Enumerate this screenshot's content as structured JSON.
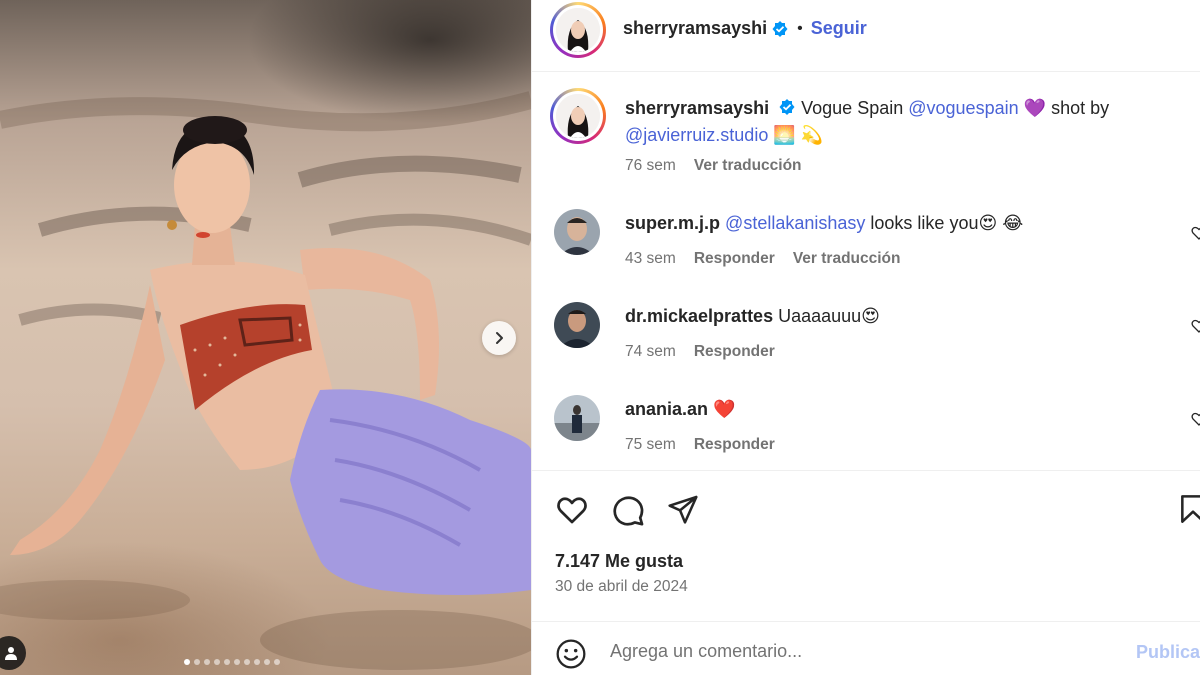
{
  "post": {
    "author": "sherryramsayshi",
    "follow_label": "Seguir",
    "separator": "•",
    "caption": {
      "prefix": "Vogue Spain",
      "mention_1": "@voguespain",
      "emoji_1": "💜",
      "middle": "shot by",
      "mention_2": "@javierruiz.studio",
      "emoji_2": "🌅 💫"
    },
    "caption_age": "76 sem",
    "translate_label": "Ver traducción",
    "likes": "7.147 Me gusta",
    "date": "30 de abril de 2024",
    "carousel_count": 10,
    "carousel_active": 0
  },
  "comments": [
    {
      "user": "super.m.j.p",
      "mention": "@stellakanishasy",
      "text": "looks like you",
      "emoji": "😍 😂",
      "age": "43 sem",
      "reply": "Responder",
      "translate": "Ver traducción"
    },
    {
      "user": "dr.mickaelprattes",
      "mention": "",
      "text": "Uaaaauuu",
      "emoji": "😍",
      "age": "74 sem",
      "reply": "Responder"
    },
    {
      "user": "anania.an",
      "mention": "",
      "text": "",
      "emoji": "❤️",
      "age": "75 sem",
      "reply": "Responder"
    }
  ],
  "composer": {
    "placeholder": "Agrega un comentario...",
    "publish_label": "Publica"
  },
  "icons": [
    "verified-icon",
    "heart-icon",
    "comment-icon",
    "share-icon",
    "bookmark-icon",
    "emoji-icon",
    "chevron-right-icon",
    "user-tag-icon"
  ],
  "colors": {
    "link": "#4a63d6",
    "verified": "#0095f6",
    "muted": "#737373",
    "publish_disabled": "#b3c6f5"
  }
}
